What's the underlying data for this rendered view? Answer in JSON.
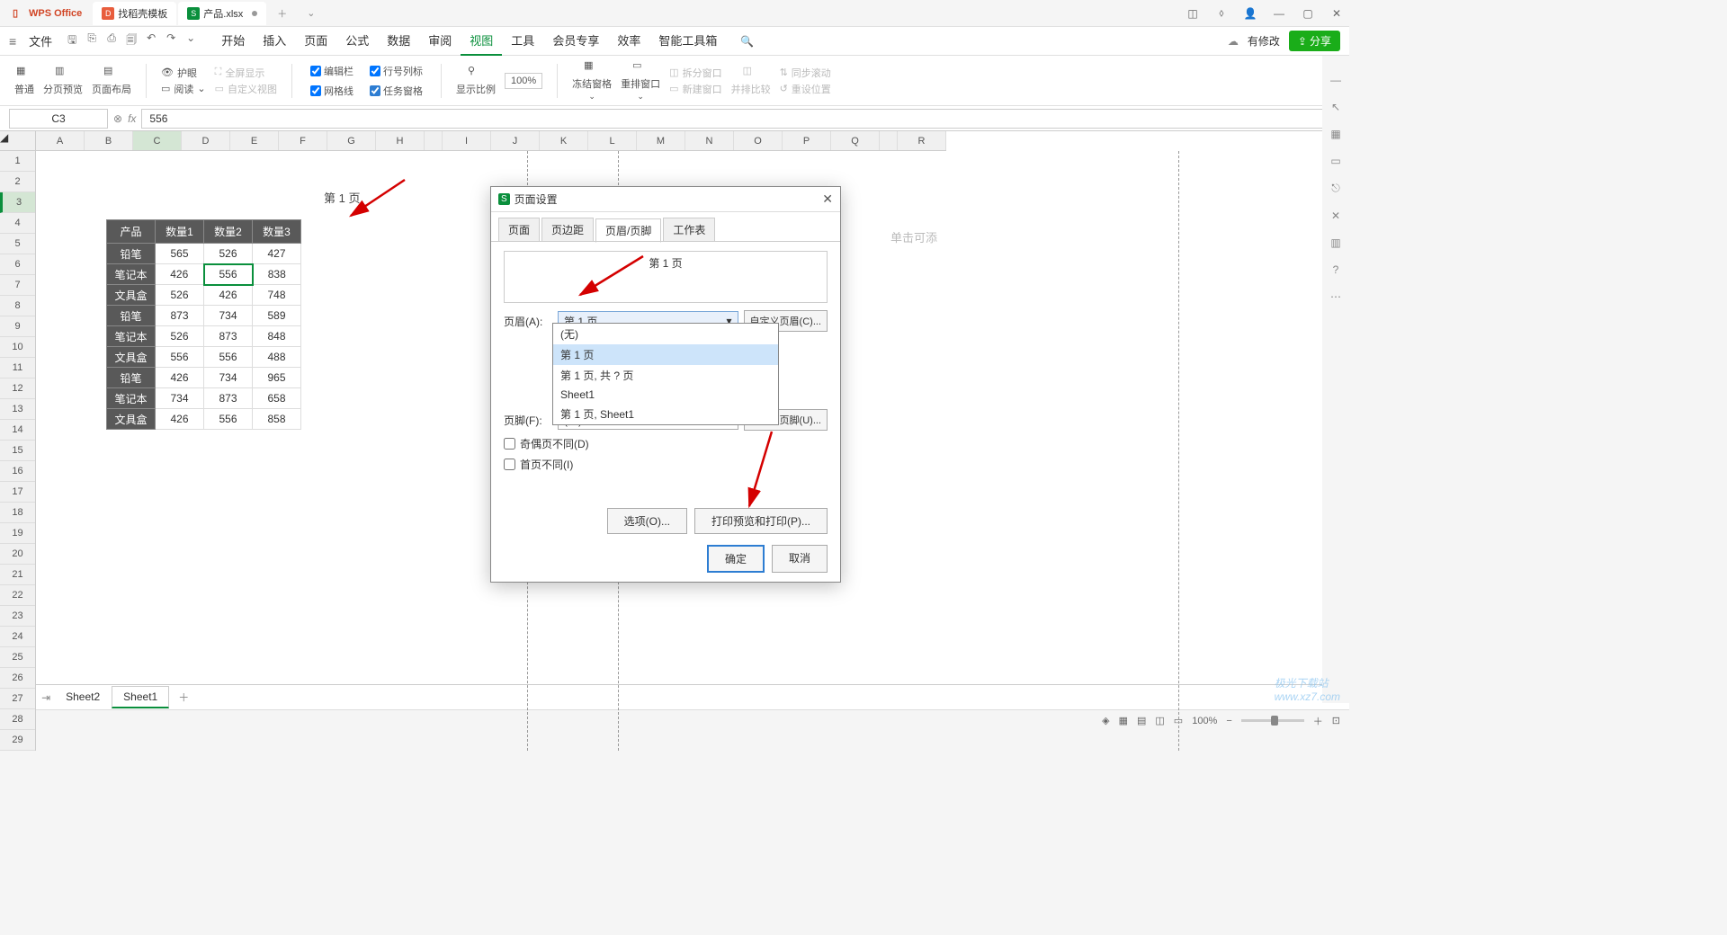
{
  "titlebar": {
    "app_name": "WPS Office",
    "template_tab": "找稻壳模板",
    "file_tab": "产品.xlsx"
  },
  "menubar": {
    "file": "文件",
    "tabs": [
      "开始",
      "插入",
      "页面",
      "公式",
      "数据",
      "审阅",
      "视图",
      "工具",
      "会员专享",
      "效率",
      "智能工具箱"
    ],
    "active_index": 6,
    "cloud_mod": "有修改",
    "share": "分享"
  },
  "ribbon": {
    "normal": "普通",
    "page_break": "分页预览",
    "page_layout": "页面布局",
    "eye_protect": "护眼",
    "fullscreen": "全屏显示",
    "read_mode": "阅读",
    "custom_view": "自定义视图",
    "edit_bar": "编辑栏",
    "row_col_label": "行号列标",
    "gridlines": "网格线",
    "task_pane": "任务窗格",
    "zoom_label": "显示比例",
    "zoom_value": "100%",
    "freeze": "冻结窗格",
    "rearrange": "重排窗口",
    "split": "拆分窗口",
    "new_window": "新建窗口",
    "compare": "并排比较",
    "sync_scroll": "同步滚动",
    "reset_pos": "重设位置"
  },
  "formula_bar": {
    "cell_ref": "C3",
    "fx": "fx",
    "value": "556"
  },
  "columns": [
    "A",
    "B",
    "C",
    "D",
    "E",
    "F",
    "G",
    "H",
    "",
    "I",
    "J",
    "K",
    "L",
    "M",
    "N",
    "O",
    "P",
    "Q",
    "",
    "R"
  ],
  "sel_col_index": 2,
  "row_count": 29,
  "sel_row_index": 2,
  "page_header_text": "第 1 页",
  "table": {
    "headers": [
      "产品",
      "数量1",
      "数量2",
      "数量3"
    ],
    "rows": [
      [
        "铅笔",
        "565",
        "526",
        "427"
      ],
      [
        "笔记本",
        "426",
        "556",
        "838"
      ],
      [
        "文具盒",
        "526",
        "426",
        "748"
      ],
      [
        "铅笔",
        "873",
        "734",
        "589"
      ],
      [
        "笔记本",
        "526",
        "873",
        "848"
      ],
      [
        "文具盒",
        "556",
        "556",
        "488"
      ],
      [
        "铅笔",
        "426",
        "734",
        "965"
      ],
      [
        "笔记本",
        "734",
        "873",
        "658"
      ],
      [
        "文具盒",
        "426",
        "556",
        "858"
      ]
    ],
    "sel_r": 1,
    "sel_c": 2
  },
  "click_hint": "单击可添",
  "dialog": {
    "title": "页面设置",
    "tabs": [
      "页面",
      "页边距",
      "页眉/页脚",
      "工作表"
    ],
    "active_tab": 2,
    "preview_text": "第 1 页",
    "header_label": "页眉(A):",
    "header_value": "第 1 页",
    "custom_header": "自定义页眉(C)...",
    "options": [
      "(无)",
      "第 1 页",
      "第 1 页, 共 ? 页",
      "Sheet1",
      "第 1 页, Sheet1"
    ],
    "option_hl": 1,
    "footer_label": "页脚(F):",
    "footer_value": "(无)",
    "custom_footer": "自定义页脚(U)...",
    "odd_even": "奇偶页不同(D)",
    "first_diff": "首页不同(I)",
    "options_btn": "选项(O)...",
    "print_preview": "打印预览和打印(P)...",
    "ok": "确定",
    "cancel": "取消"
  },
  "sheets": {
    "tabs": [
      "Sheet2",
      "Sheet1"
    ],
    "active": 1
  },
  "statusbar": {
    "zoom": "100%"
  },
  "watermark": "极光下载站\nwww.xz7.com"
}
